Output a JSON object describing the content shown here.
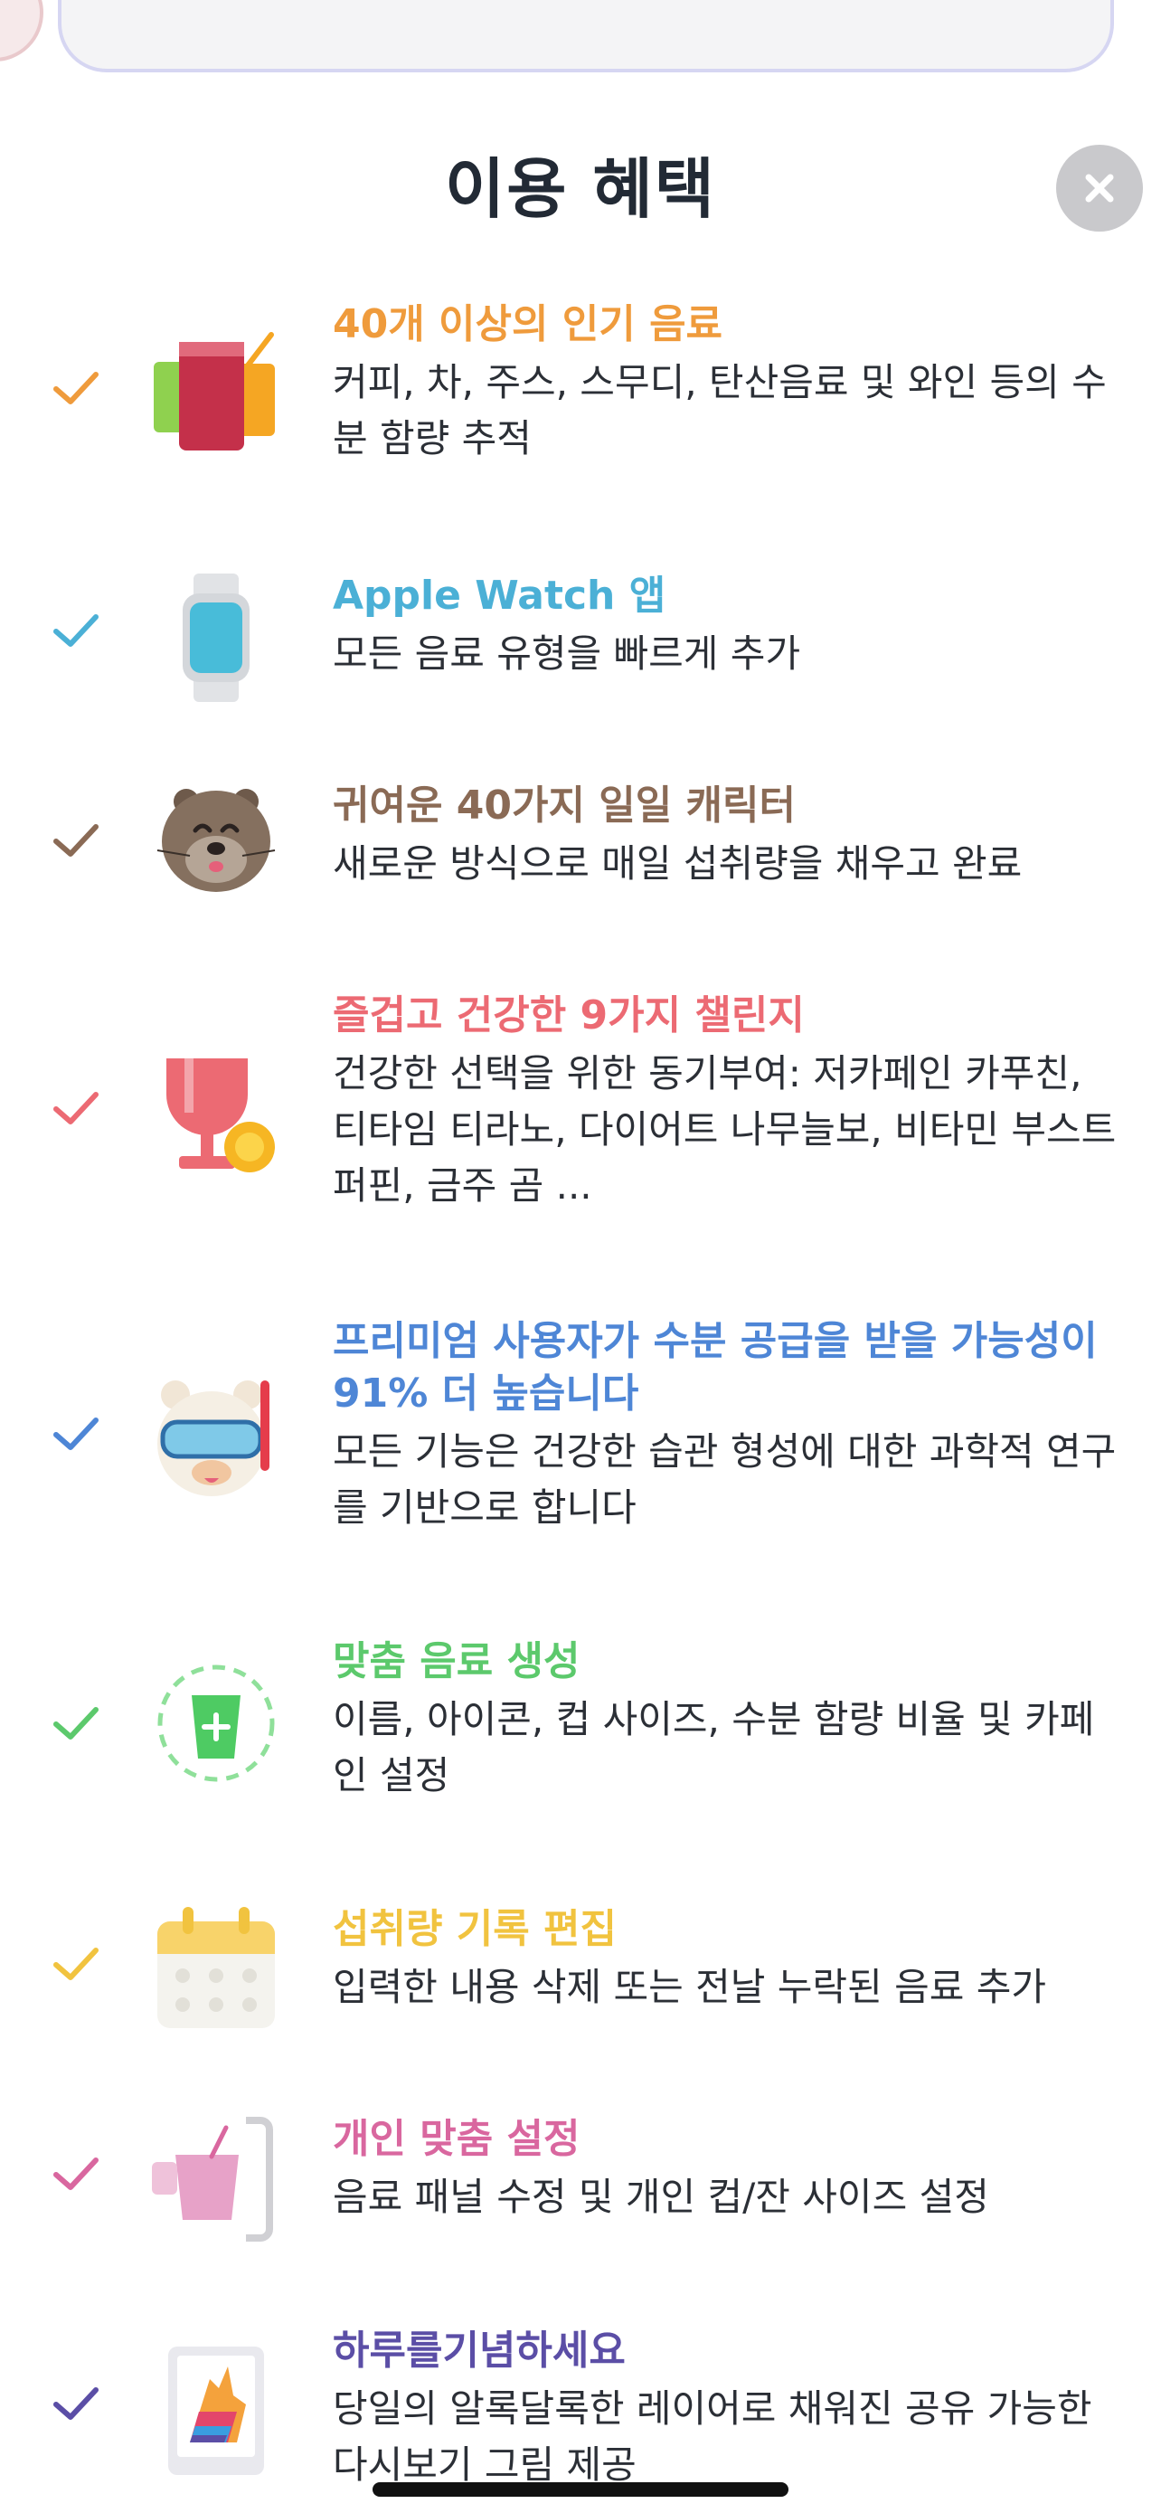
{
  "header": {
    "title": "이용 혜택"
  },
  "benefits": [
    {
      "title": "40개 이상의 인기 음료",
      "desc": "커피, 차, 주스, 스무디, 탄산음료 및 와인 등의 수분 함량 추적",
      "color": "#ef9b3c",
      "icon": "drinks-cups-icon"
    },
    {
      "title": "Apple Watch 앱",
      "desc": "모든 음료 유형을 빠르게 추가",
      "color": "#4bb0d6",
      "icon": "apple-watch-icon"
    },
    {
      "title": "귀여운 40가지 일일 캐릭터",
      "desc": "새로운 방식으로 매일 섭취량을 채우고 완료",
      "color": "#8a6a55",
      "icon": "otter-character-icon"
    },
    {
      "title": "즐겁고 건강한 9가지 챌린지",
      "desc": "건강한 선택을 위한 동기부여: 저카페인 카푸친, 티타임 티라노, 다이어트 나무늘보, 비타민 부스트 퍼핀, 금주 곰 ...",
      "color": "#ec6a73",
      "icon": "trophy-medal-icon"
    },
    {
      "title": "프리미엄 사용자가 수분 공급을 받을 가능성이 91% 더 높습니다",
      "desc": "모든 기능은 건강한 습관 형성에 대한 과학적 연구를 기반으로 합니다",
      "color": "#4e86d6",
      "icon": "llama-snorkel-icon"
    },
    {
      "title": "맞춤 음료 생성",
      "desc": "이름, 아이콘, 컵 사이즈, 수분 함량 비율 및 카페인 설정",
      "color": "#5cc96c",
      "icon": "custom-drink-icon"
    },
    {
      "title": "섭취량 기록 편집",
      "desc": "입력한 내용 삭제 또는 전날 누락된 음료 추가",
      "color": "#f1c33f",
      "icon": "calendar-icon"
    },
    {
      "title": "개인 맞춤 설정",
      "desc": "음료 패널 수정 및 개인 컵/잔 사이즈 설정",
      "color": "#d9679f",
      "icon": "cup-panel-icon"
    },
    {
      "title": "하루를기념하세요",
      "desc": "당일의 알록달록한 레이어로 채워진 공유 가능한 다시보기 그림 제공",
      "color": "#5b4ea6",
      "icon": "colorful-llama-card-icon"
    }
  ]
}
